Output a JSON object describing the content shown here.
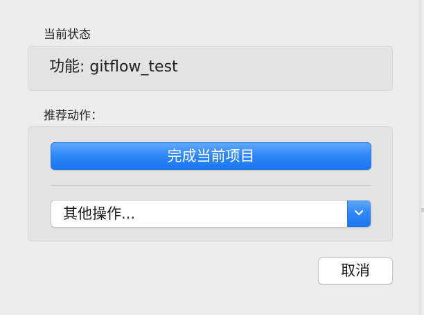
{
  "status_section": {
    "heading": "当前状态",
    "feature_text": "功能: gitflow_test"
  },
  "actions_section": {
    "heading": "推荐动作：",
    "primary_action_label": "完成当前项目",
    "other_actions_selected": "其他操作..."
  },
  "footer": {
    "cancel_label": "取消"
  },
  "icons": {
    "popup_arrow": "chevron-down-icon"
  },
  "colors": {
    "accent": "#2e86f6",
    "window_bg": "#ececec",
    "group_bg": "#e3e3e3"
  }
}
